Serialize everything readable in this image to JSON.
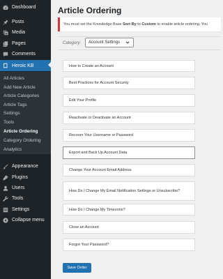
{
  "sidebar": {
    "items": [
      {
        "label": "Dashboard",
        "icon": "dashboard-icon"
      },
      {
        "label": "Posts",
        "icon": "pin-icon"
      },
      {
        "label": "Media",
        "icon": "media-icon"
      },
      {
        "label": "Pages",
        "icon": "pages-icon"
      },
      {
        "label": "Comments",
        "icon": "comment-icon"
      },
      {
        "label": "Heroic KB",
        "icon": "book-icon"
      },
      {
        "label": "Appearance",
        "icon": "paintbrush-icon"
      },
      {
        "label": "Plugins",
        "icon": "plugin-icon"
      },
      {
        "label": "Users",
        "icon": "user-icon"
      },
      {
        "label": "Tools",
        "icon": "wrench-icon"
      },
      {
        "label": "Settings",
        "icon": "settings-icon"
      },
      {
        "label": "Collapse menu",
        "icon": "collapse-icon"
      }
    ],
    "submenu": [
      "All Articles",
      "Add New Article",
      "Article Categories",
      "Article Tags",
      "Settings",
      "Tools",
      "Article Ordering",
      "Category Ordering",
      "Analytics"
    ]
  },
  "main": {
    "title": "Article Ordering",
    "notice": {
      "pre": "You must set the Knowledge Base ",
      "b1": "Sort By",
      "mid": " to ",
      "b2": "Custom",
      "post": " to enable article ordering. You"
    },
    "category_label": "Category:",
    "category_value": "Account Settings",
    "articles": [
      "How to Create an Account",
      "Best Practices for Account Security",
      "Edit Your Profile",
      "Reactivate or Deactivate an Account",
      "Recover Your Username or Password",
      "Export and Back Up Account Data",
      "Change Your Account Email Address",
      "How Do I Change My Email Notification Settings or Unsubscribe?",
      "How Do I Change My Timezone?",
      "Close an Account",
      "Forgot Your Password?"
    ],
    "save_label": "Save Order"
  },
  "colors": {
    "sidebar_bg": "#1d2327",
    "accent": "#2271b1",
    "notice_border": "#d63638"
  }
}
